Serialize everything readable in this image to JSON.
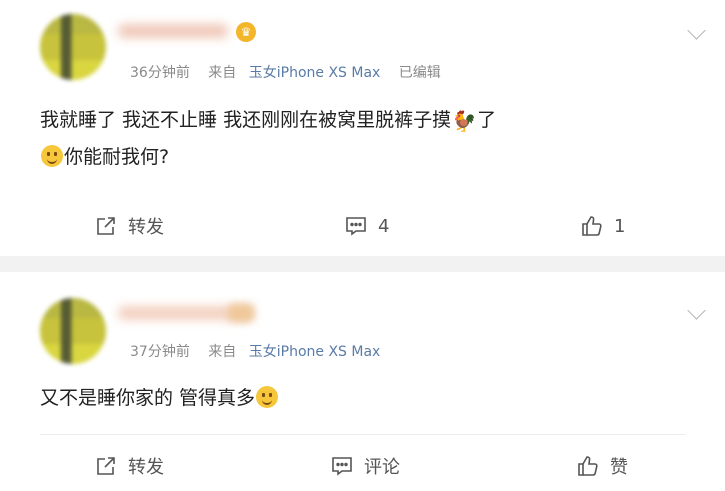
{
  "posts": [
    {
      "time": "36分钟前",
      "source_prefix": "来自",
      "source": "玉女iPhone XS Max",
      "edited": "已编辑",
      "line1": "我就睡了 我还不止睡 我还刚刚在被窝里脱裤子摸",
      "line1_tail": "了",
      "line2": "你能耐我何?",
      "repost_label": "转发",
      "comment_label": "4",
      "like_label": "1"
    },
    {
      "time": "37分钟前",
      "source_prefix": "来自",
      "source": "玉女iPhone XS Max",
      "line1": "又不是睡你家的 管得真多",
      "repost_label": "转发",
      "comment_label": "评论",
      "like_label": "赞"
    }
  ],
  "icons": {
    "repost": "repost-icon",
    "comment": "comment-icon",
    "like": "thumbs-up-icon",
    "smile": "smile-emoji",
    "rooster": "rooster-emoji",
    "crown": "crown-icon",
    "more": "chevron-down-icon"
  },
  "colors": {
    "source_link": "#5a7ba6",
    "meta": "#8a8a8a",
    "background_band": "#f2f2f2"
  }
}
